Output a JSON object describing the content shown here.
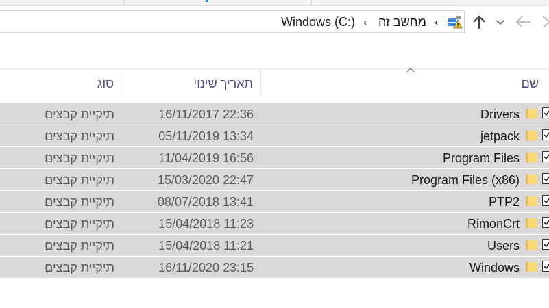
{
  "address": {
    "drive": "Windows (C:)",
    "this_pc": "מחשב זה"
  },
  "columns": {
    "name": "שם",
    "date_modified": "תאריך שינוי",
    "type": "סוג"
  },
  "files": [
    {
      "name": "Drivers",
      "date": "16/11/2017 22:36",
      "type": "תיקיית קבצים"
    },
    {
      "name": "jetpack",
      "date": "05/11/2019 13:34",
      "type": "תיקיית קבצים"
    },
    {
      "name": "Program Files",
      "date": "11/04/2019 16:56",
      "type": "תיקיית קבצים"
    },
    {
      "name": "Program Files (x86)",
      "date": "15/03/2020 22:47",
      "type": "תיקיית קבצים"
    },
    {
      "name": "PTP2",
      "date": "08/07/2018 13:41",
      "type": "תיקיית קבצים"
    },
    {
      "name": "RimonCrt",
      "date": "15/04/2018 11:23",
      "type": "תיקיית קבצים"
    },
    {
      "name": "Users",
      "date": "15/04/2018 11:21",
      "type": "תיקיית קבצים"
    },
    {
      "name": "Windows",
      "date": "16/11/2020 23:15",
      "type": "תיקיית קבצים"
    }
  ],
  "icons": {
    "folder": "folder-icon",
    "checkbox": "checkbox-checked-icon",
    "up": "arrow-up-icon",
    "back": "arrow-left-icon",
    "recent": "chevron-down-icon",
    "pc": "this-pc-warning-icon"
  },
  "colors": {
    "selection": "#d9d9d9",
    "header_text": "#4d4d8c",
    "folder": "#f3cf6a"
  }
}
